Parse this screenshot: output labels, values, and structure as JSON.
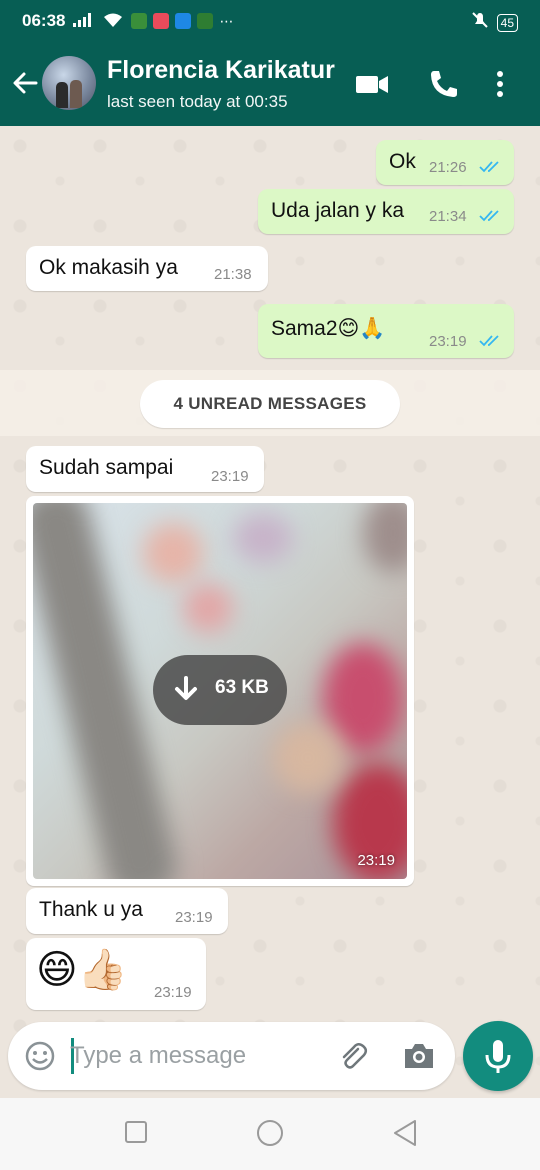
{
  "status_bar": {
    "time": "06:38",
    "battery": "45"
  },
  "header": {
    "title": "Florencia Karikatur",
    "subtitle": "last seen today at 00:35"
  },
  "messages": [
    {
      "dir": "out",
      "text": "Ok",
      "time": "21:26",
      "read": true
    },
    {
      "dir": "out",
      "text": "Uda jalan y ka",
      "time": "21:34",
      "read": true
    },
    {
      "dir": "in",
      "text": "Ok makasih ya",
      "time": "21:38"
    },
    {
      "dir": "out",
      "text": "Sama2😊🙏",
      "time": "23:19",
      "read": true
    },
    {
      "dir": "in",
      "text": "Sudah sampai",
      "time": "23:19"
    },
    {
      "dir": "in",
      "type": "image",
      "download_size": "63 KB",
      "time": "23:19"
    },
    {
      "dir": "in",
      "text": "Thank u ya",
      "time": "23:19"
    },
    {
      "dir": "in",
      "text": "😄👍🏻",
      "time": "23:19"
    }
  ],
  "unread_label": "4 UNREAD MESSAGES",
  "composer": {
    "placeholder": "Type a message"
  },
  "colors": {
    "header": "#075e54",
    "accent": "#128c7e",
    "outgoing": "#dcf8c6",
    "tick_read": "#34b7f1"
  }
}
